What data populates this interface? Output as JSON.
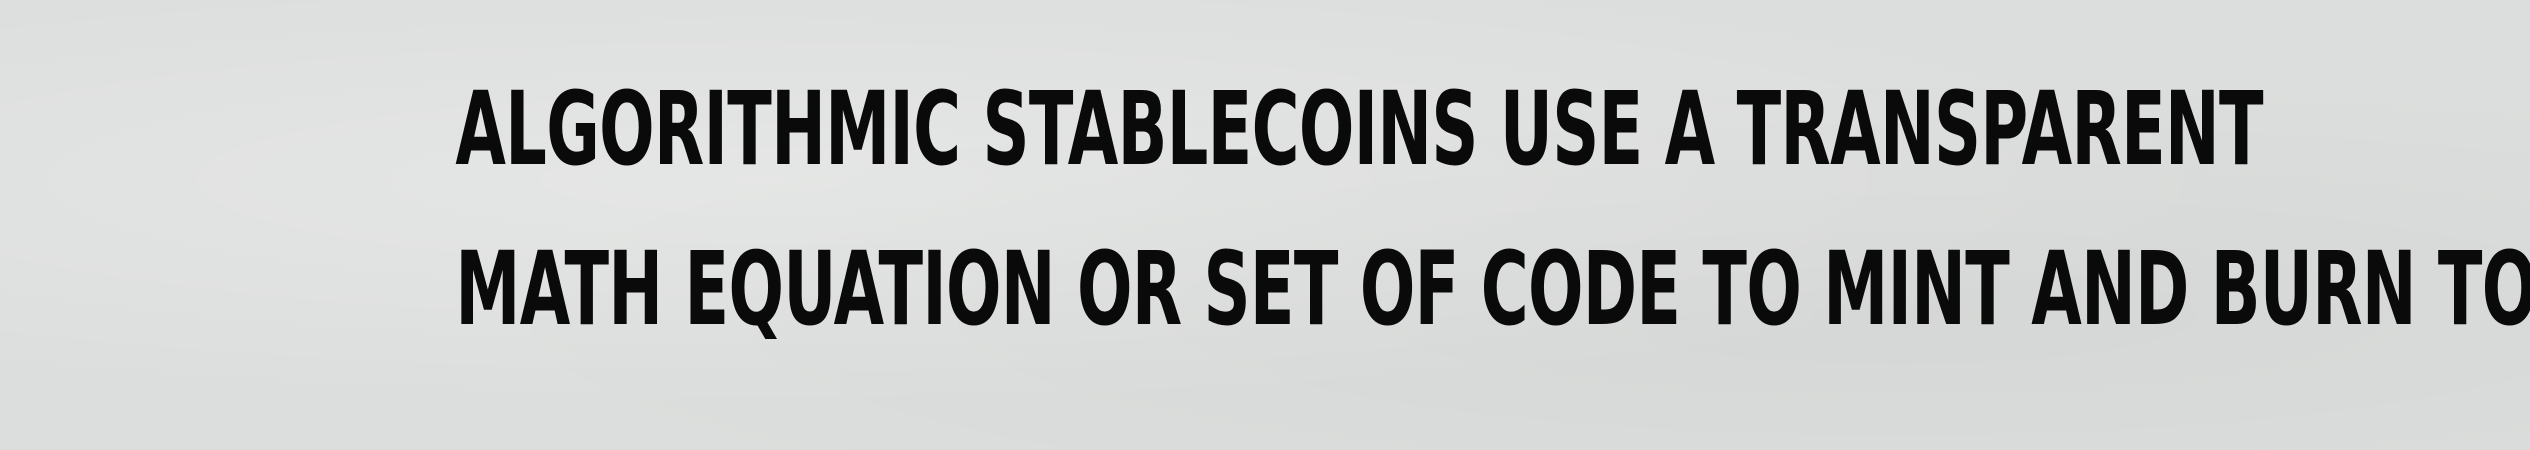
{
  "caption": {
    "line1": "ALGORITHMIC STABLECOINS USE A TRANSPARENT",
    "line2": "MATH EQUATION OR SET OF CODE TO MINT AND BURN TOKENS"
  },
  "colors": {
    "background": "#dcdedd",
    "text": "#0a0a0a"
  }
}
